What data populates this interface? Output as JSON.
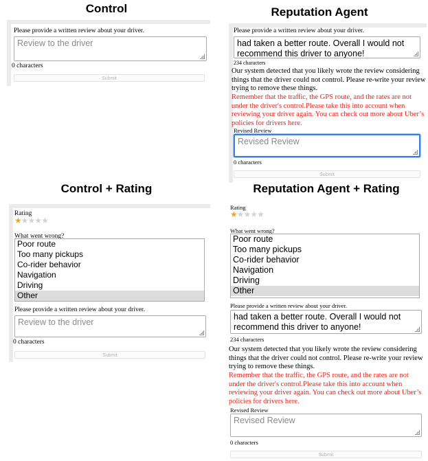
{
  "titles": {
    "control": "Control",
    "reputation": "Reputation Agent",
    "control_rating": "Control + Rating",
    "reputation_rating": "Reputation Agent + Rating"
  },
  "common": {
    "review_prompt": "Please provide a written review about your driver.",
    "review_placeholder": "Review to the driver",
    "zero_chars": "0 characters",
    "submit": "Submit",
    "rating_label": "Rating",
    "what_went_wrong": "What went wrong?",
    "revised_label": "Revised Review",
    "revised_placeholder": "Revised Review"
  },
  "rating": {
    "value": 1,
    "max": 5
  },
  "wrong_options": [
    "Poor route",
    "Too many pickups",
    "Co-rider behavior",
    "Navigation",
    "Driving",
    "Other"
  ],
  "selected_option": "Other",
  "review_text": "had taken a better route. Overall I would not recommend this driver to anyone!",
  "review_count": "234 characters",
  "detection_msg": "Our system detected that you likely wrote the review considering things that the driver could not control. Please re-write your review trying to remove these things.",
  "reminder_msg": "Remember that the traffic, the GPS route, and the rates are not under the driver's  control.Please take this into account when reviewing your driver again. You can check out more about Uber’s policies for drivers here.",
  "colors": {
    "warning": "#e8221b",
    "star_on": "#e9a534",
    "focus": "#3b7fe0"
  }
}
